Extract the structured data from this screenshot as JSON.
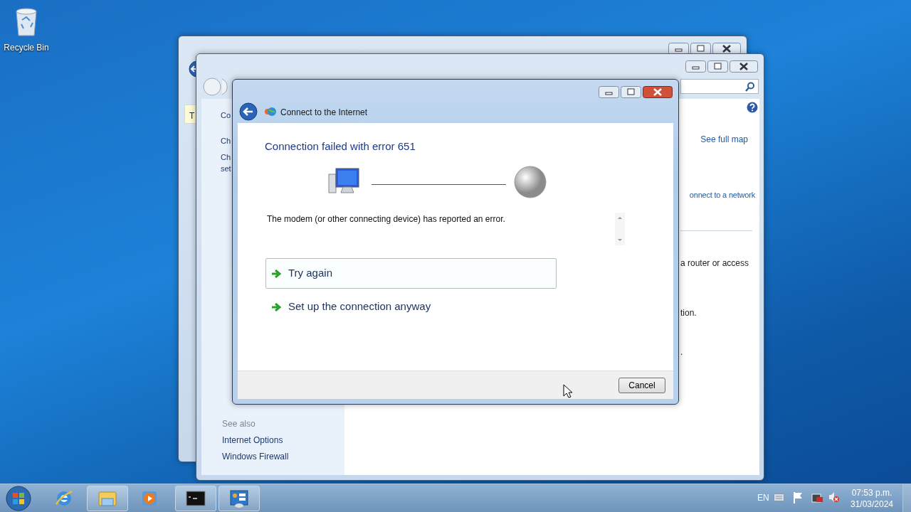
{
  "desktop_icons": [
    {
      "label": "Recycle Bin"
    }
  ],
  "back_window": {
    "banner_text": "T"
  },
  "network_window": {
    "left_texts": [
      "Co",
      "Ch",
      "Ch",
      "set"
    ],
    "see_full_map": "See full map",
    "connect_link": "onnect to a network",
    "right_texts": [
      "a router or access",
      "tion.",
      "."
    ],
    "see_also": {
      "heading": "See also",
      "links": [
        "Internet Options",
        "Windows Firewall"
      ]
    }
  },
  "dialog": {
    "title": "Connect to the Internet",
    "heading": "Connection failed with error 651",
    "message": "The modem (or other connecting device) has reported an error.",
    "options": [
      {
        "label": "Try again",
        "hovered": true
      },
      {
        "label": "Set up the connection anyway",
        "hovered": false
      }
    ],
    "buttons": [
      "Cancel"
    ]
  },
  "taskbar": {
    "apps": [
      {
        "kind": "ie",
        "open": false
      },
      {
        "kind": "explorer",
        "open": true
      },
      {
        "kind": "media",
        "open": false
      },
      {
        "kind": "cmd",
        "open": true
      },
      {
        "kind": "control",
        "open": true
      }
    ],
    "language": "EN",
    "time": "07:53 p.m.",
    "date": "31/03/2024"
  }
}
